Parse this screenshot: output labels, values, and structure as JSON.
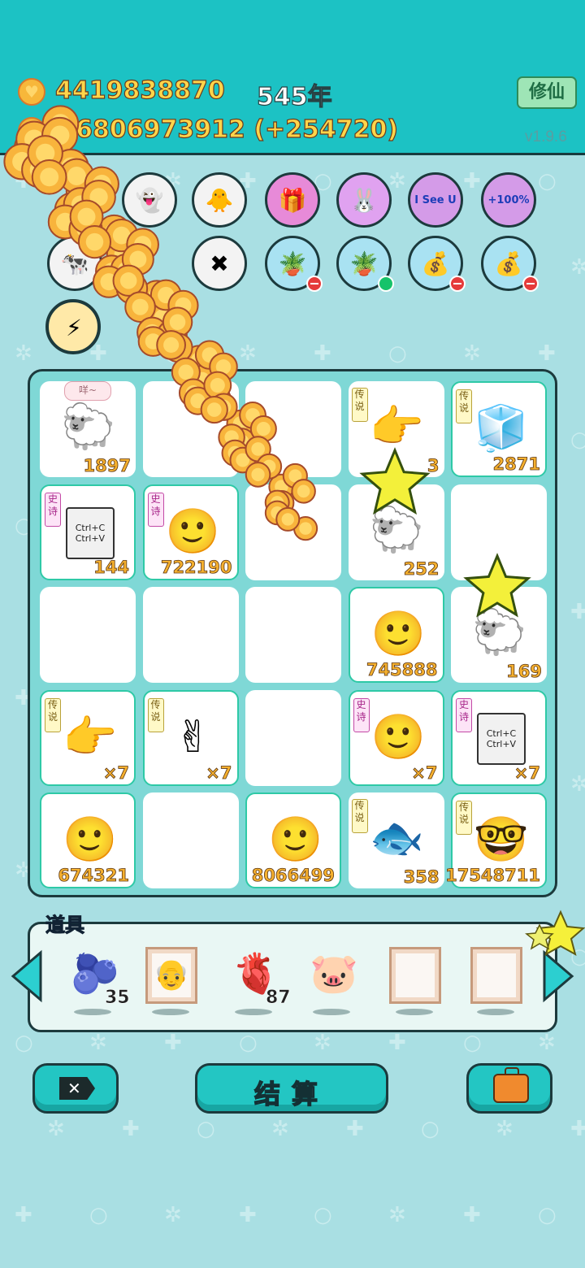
{
  "header": {
    "coins": "4419838870",
    "year": "545年",
    "income": "+6806973912 (+254720)",
    "xiuxian_label": "修仙",
    "version": "v1.9.6"
  },
  "buffs": {
    "row1": [
      {
        "icon": "ghost-icon",
        "glyph": "👻",
        "color": "#f3f3f3"
      },
      {
        "icon": "chick-icon",
        "glyph": "🐥",
        "color": "#f3f3f3"
      },
      {
        "icon": "gift-icon",
        "glyph": "🎁",
        "color": "#e78ad8"
      },
      {
        "icon": "rabbit-icon",
        "glyph": "🐰",
        "color": "#e0a2f0"
      },
      {
        "icon": "i-see-u-icon",
        "text": "I See U",
        "color": "#d49be8"
      },
      {
        "icon": "bucket-icon",
        "text": "+100%",
        "color": "#d49be8"
      }
    ],
    "row2": [
      {
        "icon": "cow-icon",
        "glyph": "🐄",
        "color": "#f3f3f3"
      },
      {
        "icon": "close-tag-icon",
        "glyph": "✖",
        "color": "#f3f3f3"
      },
      {
        "icon": "flower-pot-icon",
        "glyph": "🪴",
        "color": "#a9e2f2"
      },
      {
        "icon": "flower-pot-icon",
        "glyph": "🪴",
        "color": "#a9e2f2"
      },
      {
        "icon": "sack-icon",
        "glyph": "💰",
        "color": "#a9e2f2"
      },
      {
        "icon": "sack-icon",
        "glyph": "💰",
        "color": "#a9e2f2"
      }
    ],
    "lightning": {
      "icon": "lightning-icon",
      "glyph": "⚡"
    }
  },
  "board": [
    {
      "art": "🐑",
      "num": "1897",
      "bubble": "咩~"
    },
    {
      "art": "",
      "num": ""
    },
    {
      "art": "",
      "num": ""
    },
    {
      "art": "👉",
      "num": "3",
      "tag": "传说"
    },
    {
      "art": "🧊",
      "num": "2871",
      "tag": "传说",
      "edge": true
    },
    {
      "art": "⌘",
      "text": "Ctrl+C\nCtrl+V",
      "num": "144",
      "tag": "史诗",
      "tagType": "epic",
      "edge": true
    },
    {
      "art": "🙂",
      "num": "722190",
      "tag": "史诗",
      "tagType": "epic",
      "edge": true
    },
    {
      "art": "",
      "num": ""
    },
    {
      "art": "🐑",
      "num": "252"
    },
    {
      "art": "",
      "num": ""
    },
    {
      "art": "",
      "num": ""
    },
    {
      "art": "",
      "num": ""
    },
    {
      "art": "",
      "num": ""
    },
    {
      "art": "🙂",
      "num": "745888",
      "edge": true
    },
    {
      "art": "🐑",
      "num": "169"
    },
    {
      "art": "👉",
      "num": "×7",
      "tag": "传说",
      "edge": true
    },
    {
      "art": "✌",
      "num": "×7",
      "tag": "传说",
      "edge": true
    },
    {
      "art": "",
      "num": ""
    },
    {
      "art": "🙂",
      "num": "×7",
      "tag": "史诗",
      "tagType": "epic",
      "edge": true
    },
    {
      "art": "⌘",
      "text": "Ctrl+C\nCtrl+V",
      "num": "×7",
      "tag": "史诗",
      "tagType": "epic",
      "edge": true
    },
    {
      "art": "🙂",
      "num": "674321",
      "edge": true
    },
    {
      "art": "",
      "num": ""
    },
    {
      "art": "🙂",
      "num": "8066499",
      "edge": true
    },
    {
      "art": "🐟",
      "num": "358",
      "tag": "传说"
    },
    {
      "art": "🤓",
      "num": "17548711",
      "tag": "传说",
      "edge": true
    }
  ],
  "props": {
    "title": "道具",
    "items": [
      {
        "icon": "blueberry-icon",
        "glyph": "🫐",
        "count": "35"
      },
      {
        "icon": "portrait-frame-icon",
        "glyph": "👴",
        "count": ""
      },
      {
        "icon": "liver-icon",
        "glyph": "🫀",
        "count": "87"
      },
      {
        "icon": "piggy-bank-icon",
        "glyph": "🐷",
        "count": ""
      },
      {
        "icon": "empty-frame-icon",
        "glyph": "",
        "count": ""
      },
      {
        "icon": "empty-frame-icon",
        "glyph": "",
        "count": ""
      }
    ]
  },
  "buttons": {
    "settle": "结算"
  },
  "colors": {
    "header_bg": "#1cc2c4",
    "page_bg": "#a9dfe3",
    "coin_text": "#ffd54a",
    "button_teal": "#23c6c3"
  }
}
